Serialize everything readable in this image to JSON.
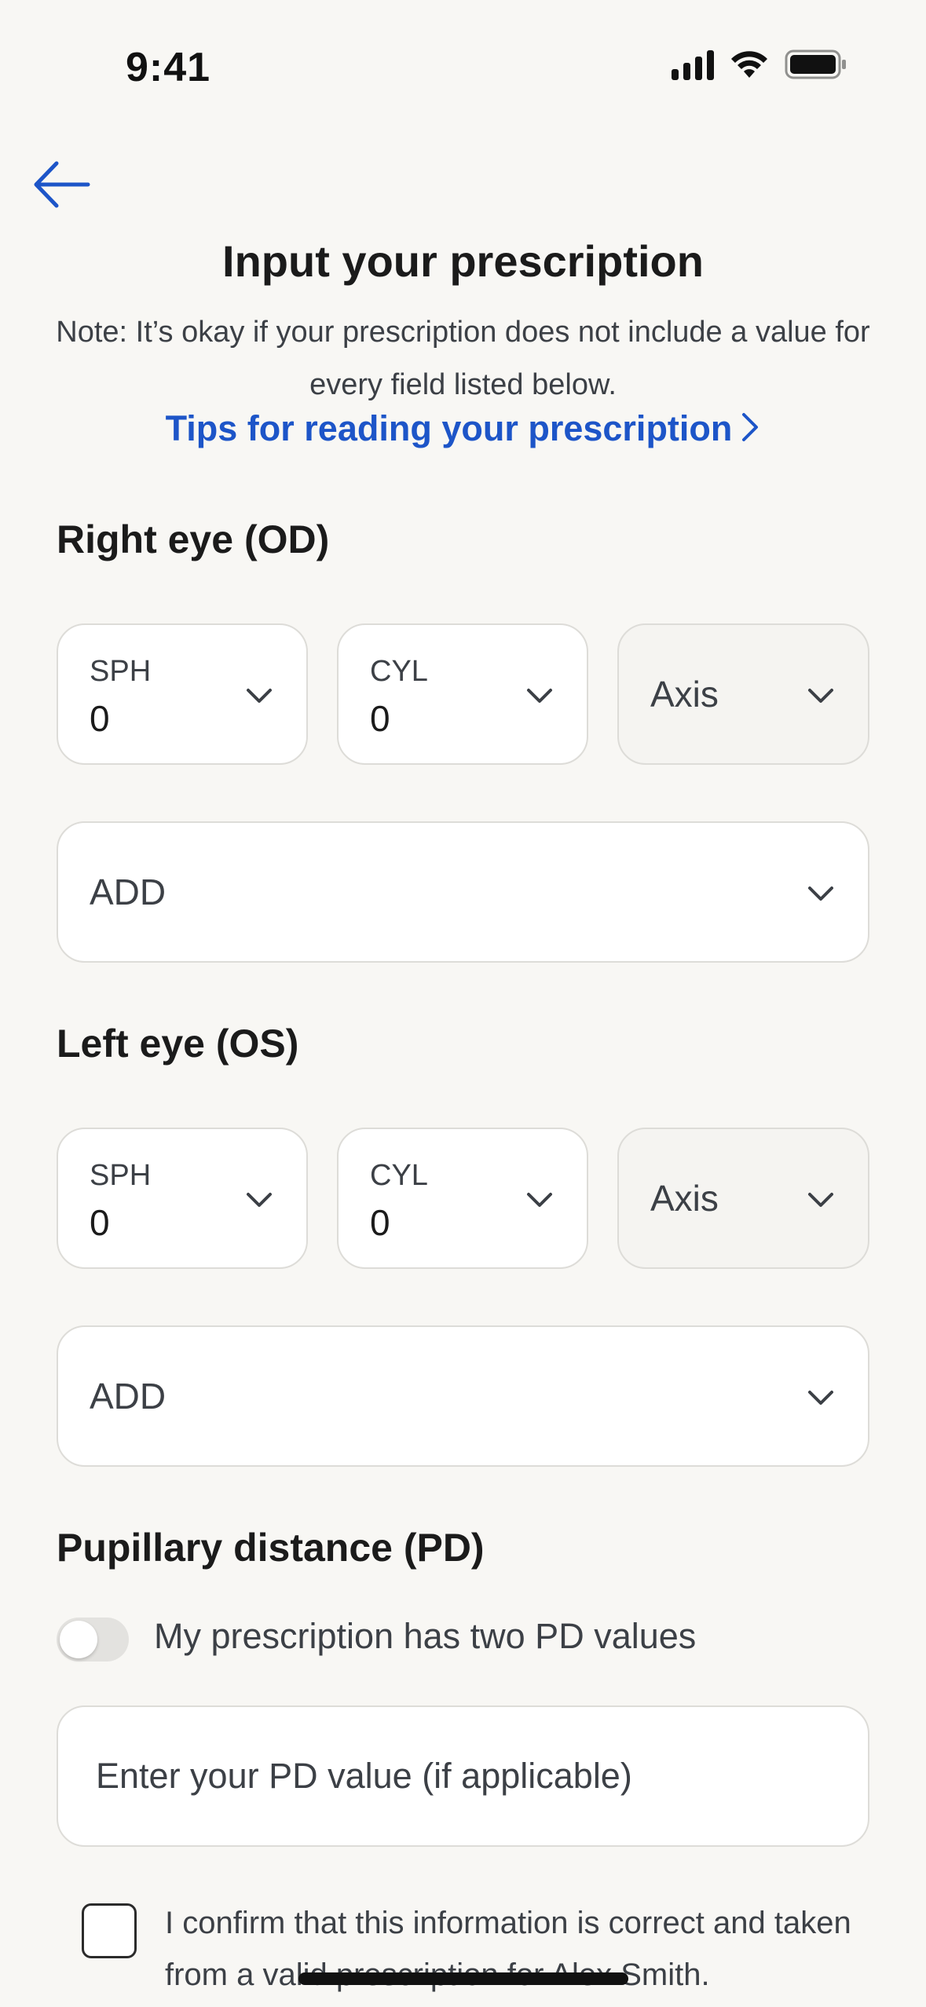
{
  "status_bar": {
    "time": "9:41"
  },
  "header": {
    "title": "Input your prescription",
    "note": "Note: It’s okay if your prescription does not include a value for every field listed below.",
    "tips_link": "Tips for reading your prescription"
  },
  "right_eye": {
    "title": "Right eye (OD)",
    "sph": {
      "label": "SPH",
      "value": "0"
    },
    "cyl": {
      "label": "CYL",
      "value": "0"
    },
    "axis": {
      "placeholder": "Axis"
    },
    "add": {
      "placeholder": "ADD"
    }
  },
  "left_eye": {
    "title": "Left eye (OS)",
    "sph": {
      "label": "SPH",
      "value": "0"
    },
    "cyl": {
      "label": "CYL",
      "value": "0"
    },
    "axis": {
      "placeholder": "Axis"
    },
    "add": {
      "placeholder": "ADD"
    }
  },
  "pd": {
    "title": "Pupillary distance (PD)",
    "toggle_label": "My prescription has two PD values",
    "toggle_on": false,
    "input_placeholder": "Enter your PD value (if applicable)"
  },
  "confirm": {
    "text": "I confirm that this information is correct and taken from a valid prescription for Alex Smith.",
    "checked": false
  },
  "colors": {
    "accent": "#1d55c8",
    "background": "#f8f7f4",
    "field_border": "#dddcd8"
  }
}
